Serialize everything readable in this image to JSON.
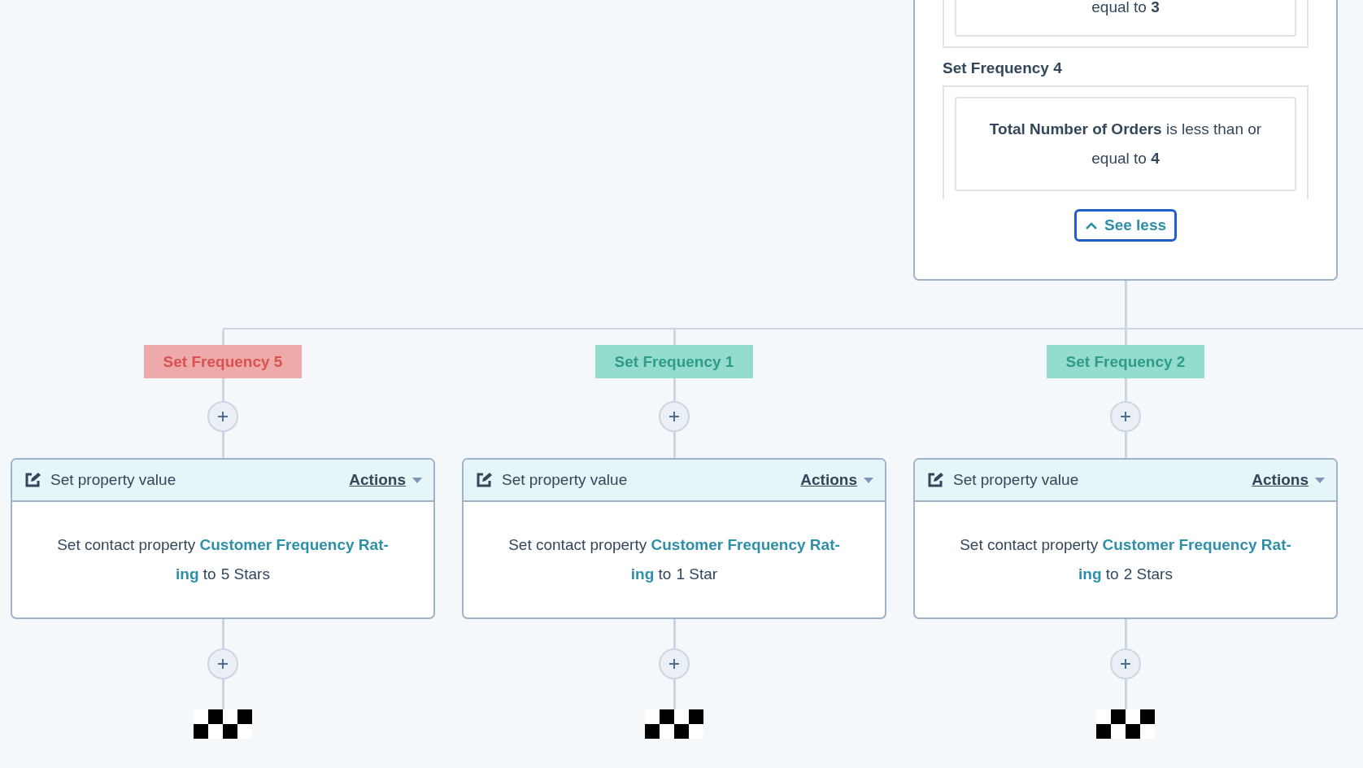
{
  "criteria_panel": {
    "top_condition": "equal to **3**",
    "branch_label": "Set Frequency 4",
    "condition": "**Total Number of Orders** is less than or equal to **4**",
    "see_less": {
      "label": "See less",
      "focused": true
    }
  },
  "branches": [
    {
      "label": "Set Frequency 5",
      "kind": "error",
      "action": {
        "title": "Set property value",
        "menu": "Actions",
        "lead": "Set contact property",
        "property_lines": [
          "Customer Frequency Rat-",
          "ing"
        ],
        "connector": "to",
        "value": "5 Stars"
      }
    },
    {
      "label": "Set Frequency 1",
      "kind": "success",
      "action": {
        "title": "Set property value",
        "menu": "Actions",
        "lead": "Set contact property",
        "property_lines": [
          "Customer Frequency Rat-",
          "ing"
        ],
        "connector": "to",
        "value": "1 Star"
      }
    },
    {
      "label": "Set Frequency 2",
      "kind": "success",
      "action": {
        "title": "Set property value",
        "menu": "Actions",
        "lead": "Set contact property",
        "property_lines": [
          "Customer Frequency Rat-",
          "ing"
        ],
        "connector": "to",
        "value": "2 Stars"
      }
    }
  ]
}
